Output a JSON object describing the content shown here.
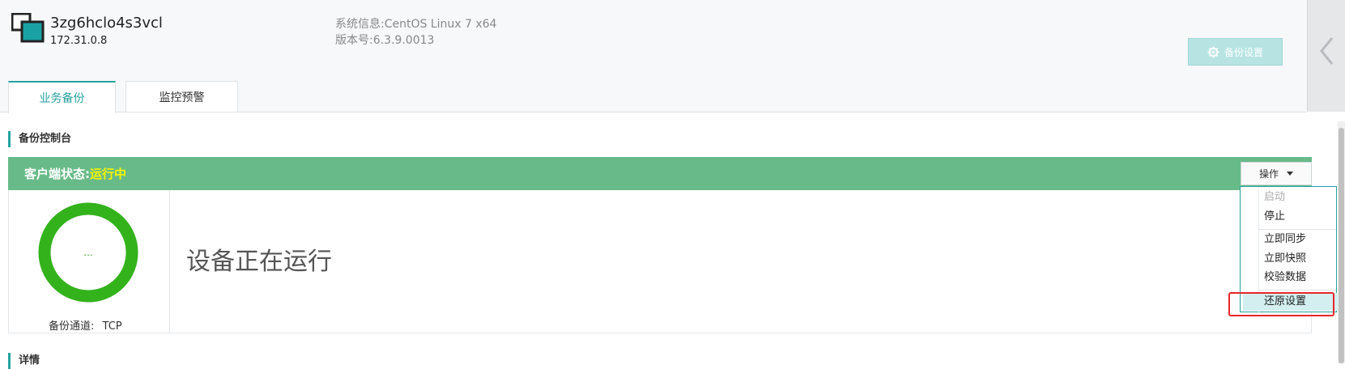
{
  "header": {
    "host_name": "3zg6hclo4s3vcl",
    "host_ip": "172.31.0.8",
    "system_info": "系统信息:CentOS Linux 7 x64",
    "version": "版本号:6.3.9.0013",
    "backup_settings_label": "备份设置"
  },
  "tabs": [
    {
      "label": "业务备份",
      "active": true
    },
    {
      "label": "监控预警",
      "active": false
    }
  ],
  "console": {
    "section_title": "备份控制台",
    "status_label": "客户端状态:",
    "status_value": "运行中",
    "ops_label": "操作",
    "ring_text": "...",
    "channel_label": "备份通道:",
    "channel_value": "TCP",
    "message": "设备正在运行"
  },
  "menu": {
    "items": [
      {
        "label": "启动",
        "disabled": true
      },
      {
        "label": "停止",
        "disabled": false
      },
      {
        "label": "立即同步",
        "disabled": false
      },
      {
        "label": "立即快照",
        "disabled": false
      },
      {
        "label": "校验数据",
        "disabled": false
      },
      {
        "label": "还原设置",
        "disabled": false,
        "highlighted": true
      }
    ]
  },
  "details": {
    "section_title": "详情"
  },
  "colors": {
    "accent": "#25a2a0",
    "status_bar": "#68bb89",
    "status_value": "#f5f500",
    "ring": "#33b21c",
    "highlight_box": "#e8282b"
  }
}
